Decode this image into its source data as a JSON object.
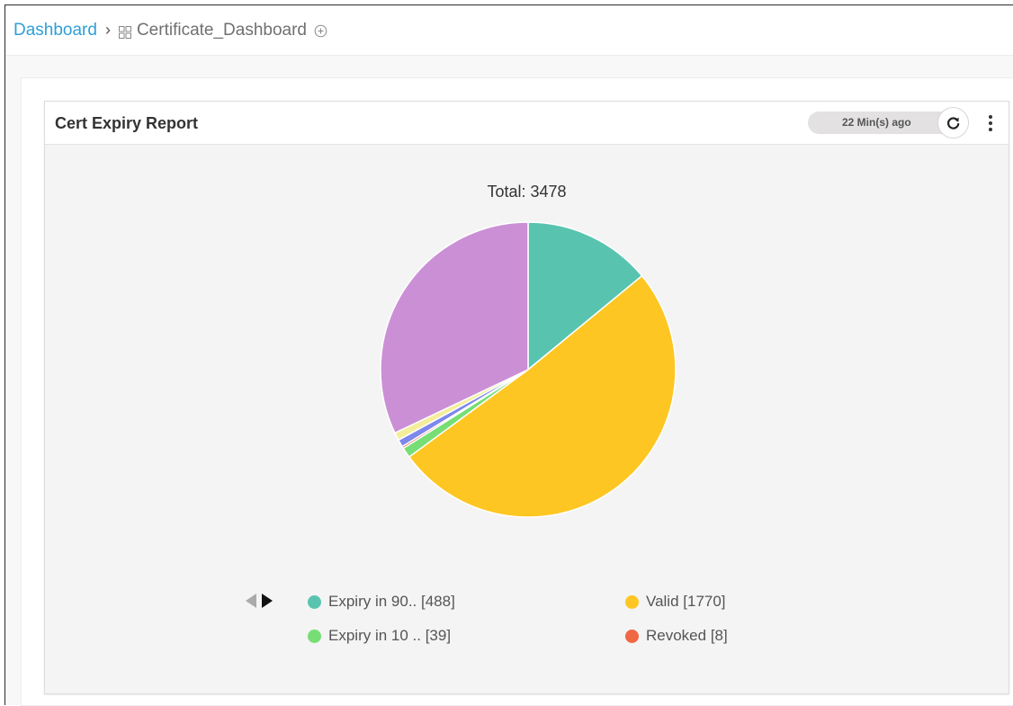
{
  "breadcrumb": {
    "root": "Dashboard",
    "current": "Certificate_Dashboard"
  },
  "widget": {
    "title": "Cert Expiry Report",
    "last_updated": "22 Min(s) ago"
  },
  "icons": {
    "grid": "grid-icon",
    "add": "plus-circle-icon",
    "refresh": "refresh-icon",
    "menu": "kebab-menu-icon",
    "prev": "triangle-left-icon",
    "next": "triangle-right-icon"
  },
  "chart_data": {
    "type": "pie",
    "title": "Total: 3478",
    "slices": [
      {
        "label": "Expiry in 90.. [488]",
        "value": 488,
        "color": "#58c4b0"
      },
      {
        "label": "Valid [1770]",
        "value": 1770,
        "color": "#fec622"
      },
      {
        "label": "Expiry in 10 .. [39]",
        "value": 39,
        "color": "#76de74"
      },
      {
        "label": "Revoked [8]",
        "value": 8,
        "color": "#f06744"
      },
      {
        "label": "",
        "value": 28,
        "color": "#7d87ec"
      },
      {
        "label": "",
        "value": 30,
        "color": "#f4ee9a"
      },
      {
        "label": "",
        "value": 1115,
        "color": "#cb8fd6"
      }
    ],
    "legend_placement": "bottom"
  }
}
